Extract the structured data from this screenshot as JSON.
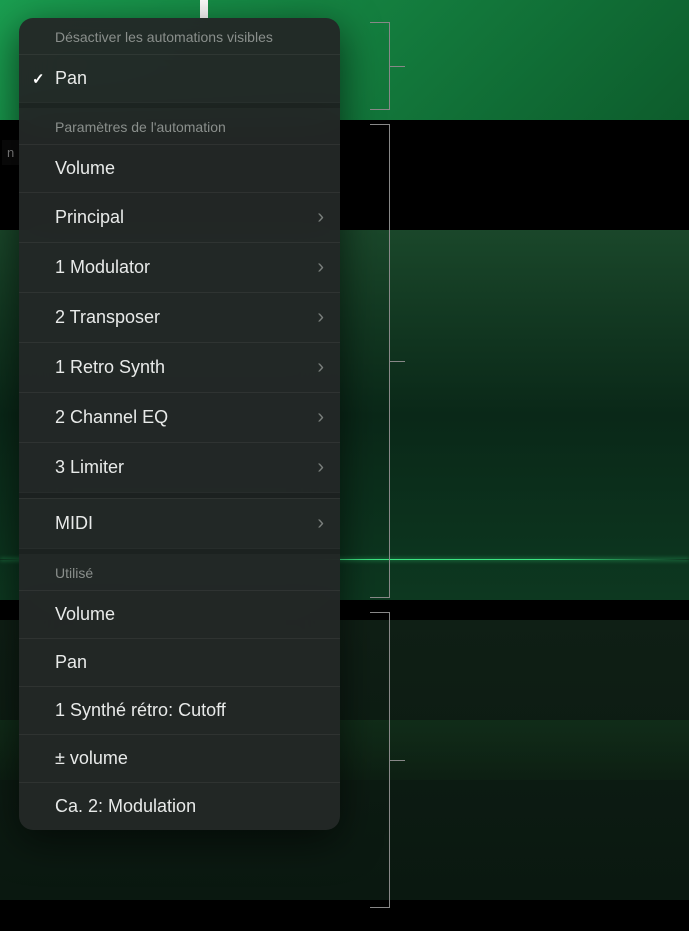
{
  "side_label": "n",
  "sections": {
    "disable": {
      "header": "Désactiver les automations visibles",
      "items": {
        "pan": "Pan"
      }
    },
    "params": {
      "header": "Paramètres de l'automation",
      "items": {
        "volume": "Volume",
        "principal": "Principal",
        "modulator": "1 Modulator",
        "transposer": "2 Transposer",
        "retrosynth": "1 Retro Synth",
        "channeleq": "2 Channel EQ",
        "limiter": "3 Limiter",
        "midi": "MIDI"
      }
    },
    "used": {
      "header": "Utilisé",
      "items": {
        "volume": "Volume",
        "pan": "Pan",
        "cutoff": "1 Synthé rétro: Cutoff",
        "pmvolume": "± volume",
        "modulation": "Ca. 2: Modulation"
      }
    }
  }
}
